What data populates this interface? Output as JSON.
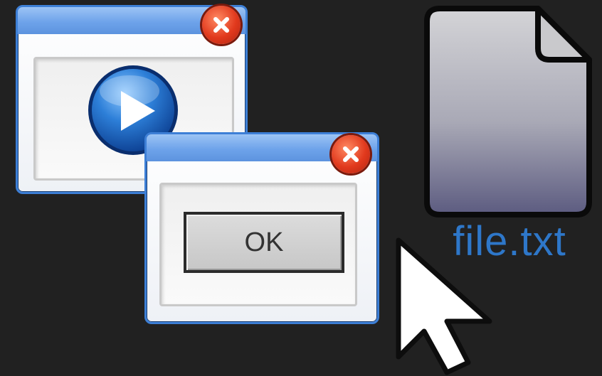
{
  "desktop": {
    "background_color": "#212121"
  },
  "windows": [
    {
      "name": "media-window",
      "icon": "play-icon",
      "close_icon": "close-icon",
      "titlebar_color": "#6ea3ea",
      "close_color": "#e1391d"
    },
    {
      "name": "dialog-window",
      "close_icon": "close-icon",
      "ok_label": "OK"
    }
  ],
  "file": {
    "icon": "file-icon",
    "label": "file.txt",
    "label_color": "#2e77c9"
  },
  "pointer": {
    "icon": "mouse-cursor-icon"
  }
}
